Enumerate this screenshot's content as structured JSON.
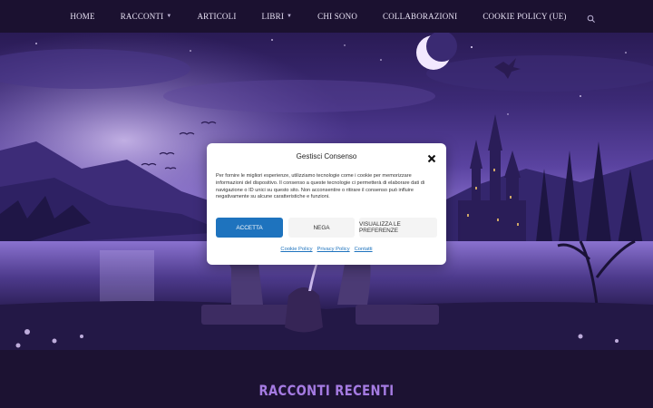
{
  "nav": {
    "items": [
      {
        "label": "HOME",
        "has_dropdown": false
      },
      {
        "label": "RACCONTI",
        "has_dropdown": true
      },
      {
        "label": "ARTICOLI",
        "has_dropdown": false
      },
      {
        "label": "LIBRI",
        "has_dropdown": true
      },
      {
        "label": "CHI SONO",
        "has_dropdown": false
      },
      {
        "label": "COLLABORAZIONI",
        "has_dropdown": false
      },
      {
        "label": "COOKIE POLICY (UE)",
        "has_dropdown": false
      }
    ],
    "search_icon": "search-icon"
  },
  "consent": {
    "title": "Gestisci Consenso",
    "body": "Per fornire le migliori esperienze, utilizziamo tecnologie come i cookie per memorizzare informazioni del dispositivo. Il consenso a queste tecnologie ci permetterà di elaborare dati di navigazione o ID unici su questo sito. Non acconsentire o ritirare il consenso può influire negativamente su alcune caratteristiche e funzioni.",
    "accept_label": "Accetta",
    "deny_label": "Nega",
    "preferences_label": "Visualizza le preferenze",
    "links": [
      "Cookie Policy",
      "Privacy Policy",
      "Contatti"
    ],
    "close_icon": "close-icon"
  },
  "section": {
    "title": "RACCONTI RECENTI"
  },
  "colors": {
    "nav_bg": "#1b1130",
    "accent": "#a57be2",
    "accept_button": "#1e73be"
  }
}
